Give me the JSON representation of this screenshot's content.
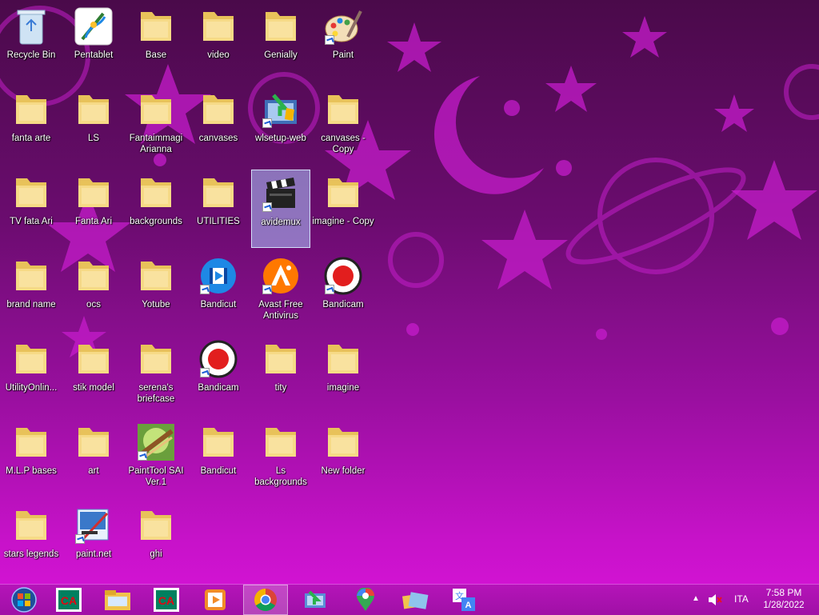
{
  "colors": {
    "accent": "#d814d8",
    "selection": "#adc8ff",
    "folder": "#f4d77c"
  },
  "desktop": {
    "icons": [
      {
        "label": "Recycle Bin",
        "icon": "recycle-bin-icon"
      },
      {
        "label": "Pentablet",
        "icon": "pentablet-icon"
      },
      {
        "label": "Base",
        "icon": "folder-icon"
      },
      {
        "label": "video",
        "icon": "folder-icon"
      },
      {
        "label": "Genially",
        "icon": "folder-icon"
      },
      {
        "label": "Paint",
        "icon": "paint-icon"
      },
      {
        "label": "fanta arte",
        "icon": "folder-icon"
      },
      {
        "label": "LS",
        "icon": "folder-icon"
      },
      {
        "label": "Fantaimmagi Arianna",
        "icon": "folder-icon"
      },
      {
        "label": "canvases",
        "icon": "folder-icon"
      },
      {
        "label": "wlsetup-web",
        "icon": "setup-icon"
      },
      {
        "label": "canvases - Copy",
        "icon": "folder-icon"
      },
      {
        "label": "TV fata Ari",
        "icon": "folder-icon"
      },
      {
        "label": "Fanta Ari",
        "icon": "folder-icon"
      },
      {
        "label": "backgrounds",
        "icon": "folder-icon"
      },
      {
        "label": "UTILITIES",
        "icon": "folder-icon"
      },
      {
        "label": "avidemux",
        "icon": "clapperboard-icon"
      },
      {
        "label": "imagine - Copy",
        "icon": "folder-icon"
      },
      {
        "label": "brand name",
        "icon": "folder-icon"
      },
      {
        "label": "ocs",
        "icon": "folder-icon"
      },
      {
        "label": "Yotube",
        "icon": "folder-icon"
      },
      {
        "label": "Bandicut",
        "icon": "bandicut-icon"
      },
      {
        "label": "Avast Free Antivirus",
        "icon": "avast-icon"
      },
      {
        "label": "Bandicam",
        "icon": "bandicam-icon"
      },
      {
        "label": "UtilityOnlin...",
        "icon": "folder-icon"
      },
      {
        "label": "stik model",
        "icon": "folder-icon"
      },
      {
        "label": "serena's briefcase",
        "icon": "folder-icon"
      },
      {
        "label": "Bandicam",
        "icon": "bandicam-icon"
      },
      {
        "label": "tity",
        "icon": "folder-icon"
      },
      {
        "label": "imagine",
        "icon": "folder-icon"
      },
      {
        "label": "M.L.P bases",
        "icon": "folder-icon"
      },
      {
        "label": "art",
        "icon": "folder-icon"
      },
      {
        "label": "PaintTool SAI Ver.1",
        "icon": "painttool-sai-icon"
      },
      {
        "label": "Bandicut",
        "icon": "folder-icon"
      },
      {
        "label": "Ls backgrounds",
        "icon": "folder-icon"
      },
      {
        "label": "New folder",
        "icon": "folder-icon"
      },
      {
        "label": "stars legends",
        "icon": "folder-icon"
      },
      {
        "label": "paint.net",
        "icon": "paint-net-icon"
      },
      {
        "label": "ghi",
        "icon": "folder-icon"
      }
    ]
  },
  "taskbar": {
    "apps": [
      {
        "icon": "start-orb-icon"
      },
      {
        "icon": "credit-agricole-icon"
      },
      {
        "icon": "file-explorer-icon"
      },
      {
        "icon": "credit-agricole-icon"
      },
      {
        "icon": "media-player-icon"
      },
      {
        "icon": "chrome-icon"
      },
      {
        "icon": "setup-icon"
      },
      {
        "icon": "google-maps-icon"
      },
      {
        "icon": "folders-icon"
      },
      {
        "icon": "translate-icon"
      }
    ],
    "tray": {
      "language": "ITA",
      "time": "7:58 PM",
      "date": "1/28/2022"
    }
  }
}
